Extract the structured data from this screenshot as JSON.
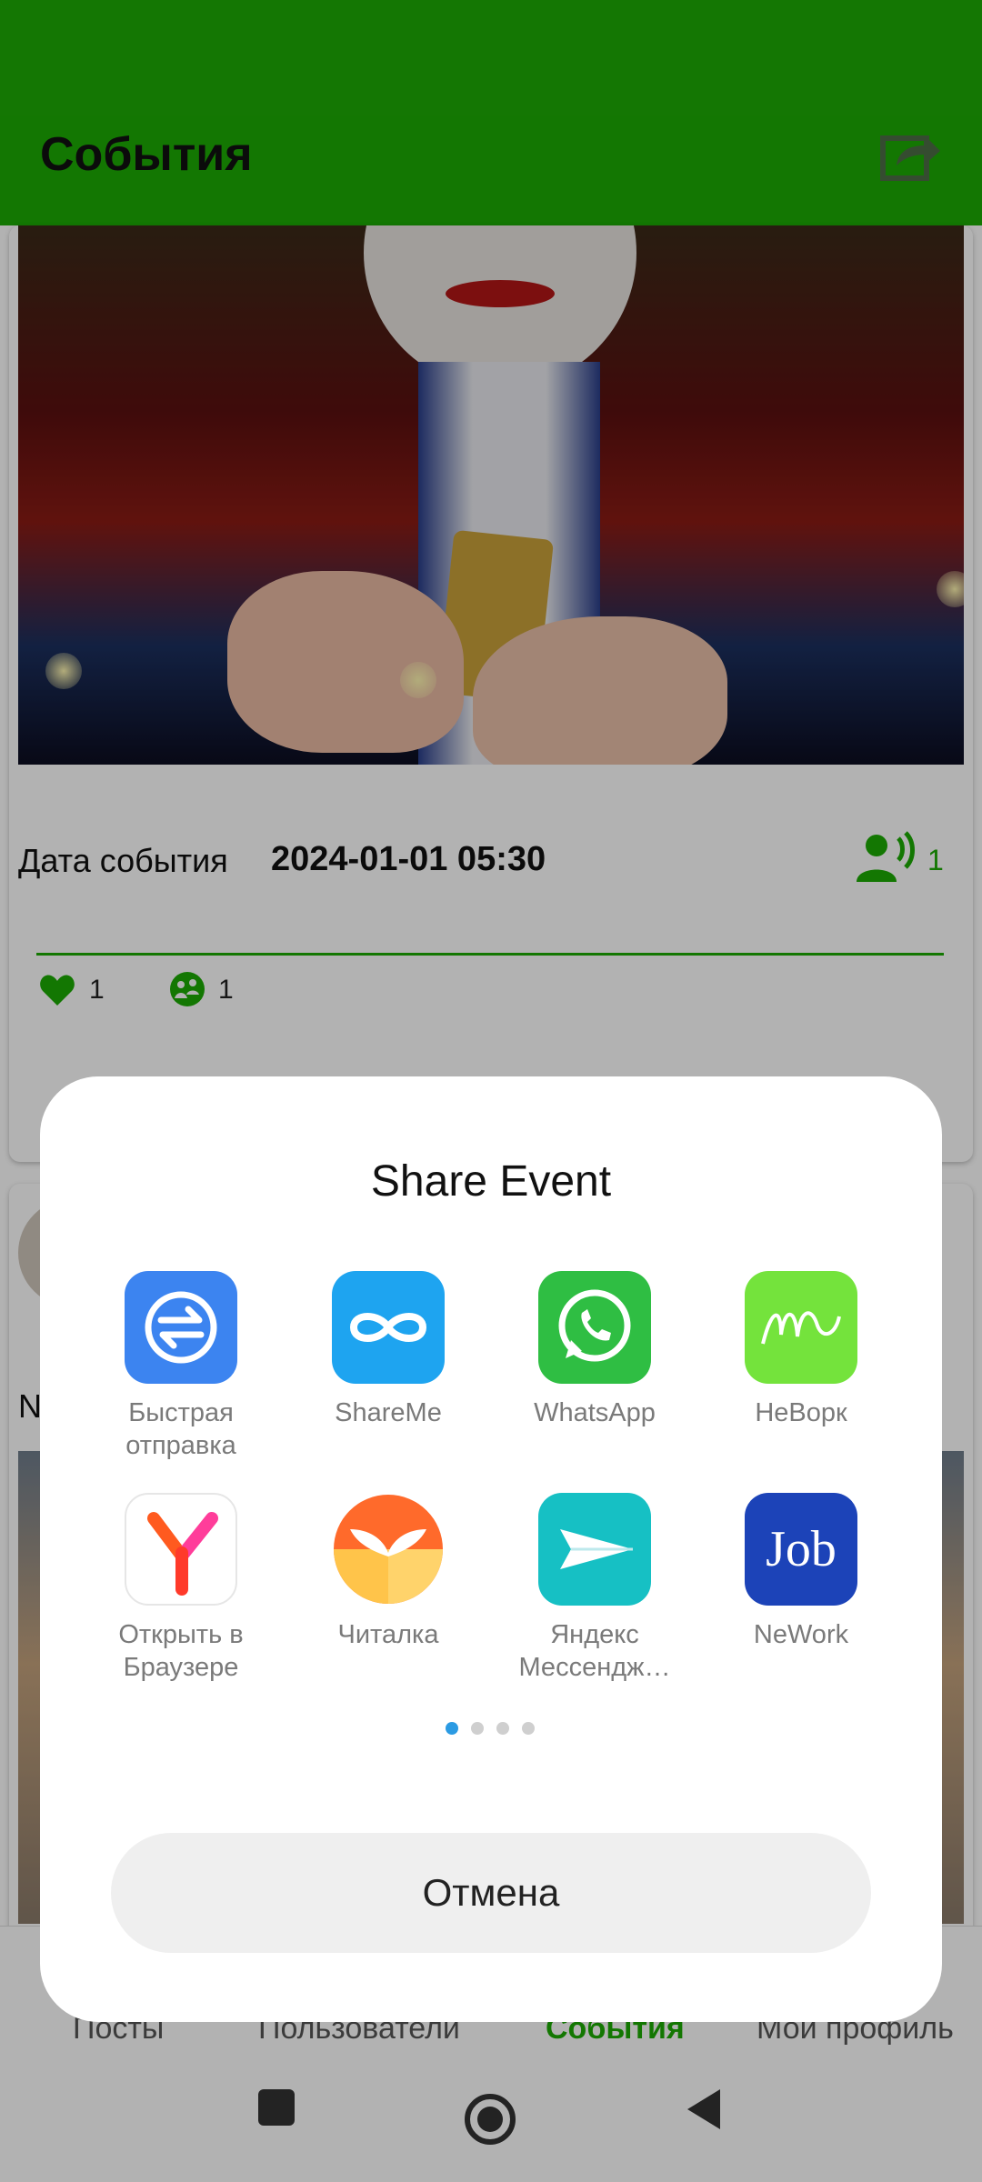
{
  "header": {
    "title": "События",
    "share_icon": "share-icon",
    "color": "#1cab04"
  },
  "event": {
    "date_label": "Дата события",
    "date_value": "2024-01-01 05:30",
    "participants_count": "1",
    "likes_count": "1",
    "speakers_count": "1"
  },
  "next_card": {
    "letter": "N"
  },
  "bottom_nav": {
    "items": [
      {
        "label": "Посты"
      },
      {
        "label": "Пользователи"
      },
      {
        "label": "События"
      },
      {
        "label": "Мой профиль"
      }
    ],
    "active_index": 2
  },
  "share_dialog": {
    "title": "Share Event",
    "apps": [
      {
        "label": "Быстрая\nотправка",
        "icon": "quick-send-icon"
      },
      {
        "label": "ShareMe",
        "icon": "shareme-icon"
      },
      {
        "label": "WhatsApp",
        "icon": "whatsapp-icon"
      },
      {
        "label": "НеВорк",
        "icon": "nework-app-icon"
      },
      {
        "label": "Открыть в\nБраузере",
        "icon": "yandex-browser-icon"
      },
      {
        "label": "Читалка",
        "icon": "reader-icon"
      },
      {
        "label": "Яндекс\nМессендж…",
        "icon": "yandex-messenger-icon"
      },
      {
        "label": "NeWork",
        "icon": "job-icon"
      }
    ],
    "page_indicator": {
      "pages": 4,
      "current": 1
    },
    "cancel_label": "Отмена"
  }
}
